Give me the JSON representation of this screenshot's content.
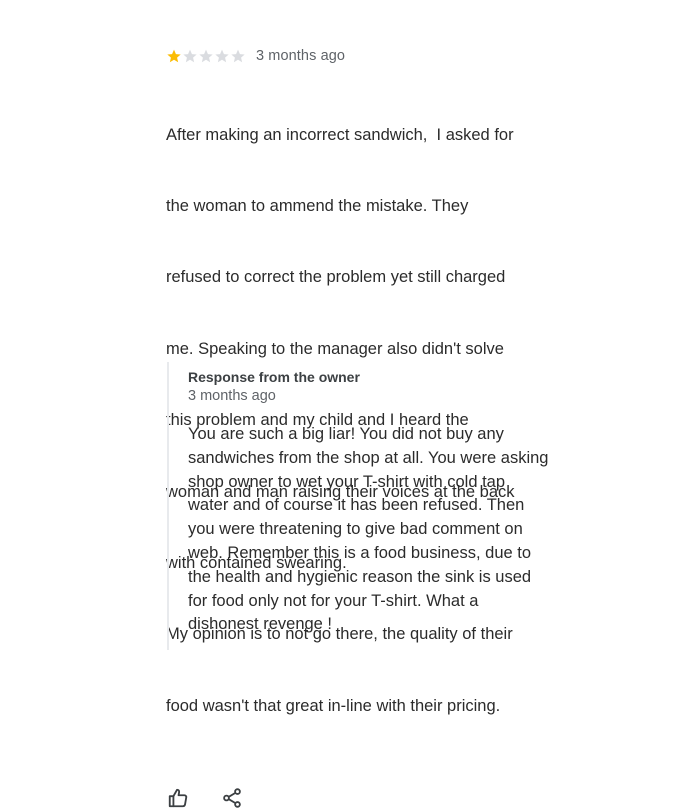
{
  "review": {
    "rating": 1,
    "max_rating": 5,
    "date": "3 months ago",
    "text_lines": [
      "After making an incorrect sandwich,  I asked for",
      "the woman to ammend the mistake. They",
      "refused to correct the problem yet still charged",
      "me. Speaking to the manager also didn't solve",
      "this problem and my child and I heard the",
      "woman and man raising their voices at the back",
      "with contained swearing.",
      "My opinion is to not go there, the quality of their",
      "food wasn't that great in-line with their pricing."
    ],
    "actions": [
      {
        "icon": "thumbs-up-icon"
      },
      {
        "icon": "share-icon"
      }
    ]
  },
  "owner_response": {
    "title": "Response from the owner",
    "date": "3 months ago",
    "text_lines": [
      "You are such a big liar! You did not buy any",
      "sandwiches from the shop at all. You were asking",
      "shop owner to wet your T-shirt with cold tap",
      "water and of course it has been refused. Then",
      "you were threatening to give bad comment on",
      "web. Remember this is a food business, due to",
      "the health and hygienic reason the sink is used",
      "for food only not for your T-shirt. What a",
      "dishonest revenge !"
    ]
  },
  "colors": {
    "star_filled": "#fbbc04",
    "star_empty": "#dadce0",
    "secondary_text": "#5f6368",
    "body_text": "#2b2b2b",
    "divider": "#e8eaed"
  }
}
